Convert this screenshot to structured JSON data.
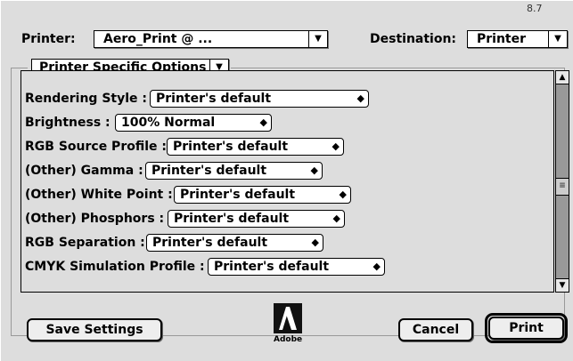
{
  "version": "8.7",
  "printer": {
    "label": "Printer:",
    "value": "Aero_Print @ ..."
  },
  "destination": {
    "label": "Destination:",
    "value": "Printer"
  },
  "section": {
    "value": "Printer Specific Options"
  },
  "options": [
    {
      "label": "Rendering Style :",
      "value": "Printer's default"
    },
    {
      "label": "Brightness :",
      "value": "100% Normal"
    },
    {
      "label": "RGB Source Profile :",
      "value": "Printer's default"
    },
    {
      "label": "(Other) Gamma :",
      "value": "Printer's default"
    },
    {
      "label": "(Other) White Point :",
      "value": "Printer's default"
    },
    {
      "label": "(Other) Phosphors :",
      "value": "Printer's default"
    },
    {
      "label": "RGB Separation :",
      "value": "Printer's default"
    },
    {
      "label": "CMYK Simulation Profile :",
      "value": "Printer's default"
    }
  ],
  "buttons": {
    "save": "Save Settings",
    "cancel": "Cancel",
    "print": "Print"
  },
  "logo": {
    "text": "Adobe"
  },
  "icons": {
    "popup": "triangle-down-icon",
    "stepper": "up-down-arrows-icon",
    "scroll_up": "scroll-up-arrow-icon",
    "scroll_down": "scroll-down-arrow-icon",
    "logo": "adobe-logo-icon"
  }
}
